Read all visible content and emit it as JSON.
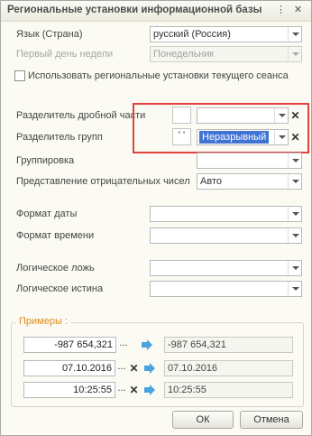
{
  "window": {
    "title": "Региональные установки информационной базы",
    "menu_icon": "more-icon",
    "close_icon": "close-icon"
  },
  "fields": {
    "language_label": "Язык (Страна)",
    "language_value": "русский (Россия)",
    "first_day_label": "Первый день недели",
    "first_day_value": "Понедельник",
    "use_session_label": "Использовать региональные установки текущего сеанса",
    "decimal_sep_label": "Разделитель дробной части",
    "decimal_sep_value": "",
    "group_sep_label": "Разделитель групп",
    "group_sep_value": "' '",
    "group_sep_selected": "Неразрывный",
    "grouping_label": "Группировка",
    "grouping_value": "",
    "neg_label": "Представление отрицательных чисел",
    "neg_value": "Авто",
    "date_format_label": "Формат даты",
    "date_format_value": "",
    "time_format_label": "Формат времени",
    "time_format_value": "",
    "bool_false_label": "Логическое ложь",
    "bool_false_value": "",
    "bool_true_label": "Логическое истина",
    "bool_true_value": ""
  },
  "examples": {
    "title": "Примеры :",
    "number_input": "-987 654,321",
    "number_result": "-987 654,321",
    "date_input": "07.10.2016",
    "date_result": "07.10.2016",
    "time_input": "10:25:55",
    "time_result": "10:25:55"
  },
  "buttons": {
    "ok": "ОК",
    "cancel": "Отмена"
  },
  "colors": {
    "highlight_border": "#e0423f",
    "selection": "#3f73d4",
    "group_title": "#e08a1c",
    "arrow": "#4aa3df"
  }
}
